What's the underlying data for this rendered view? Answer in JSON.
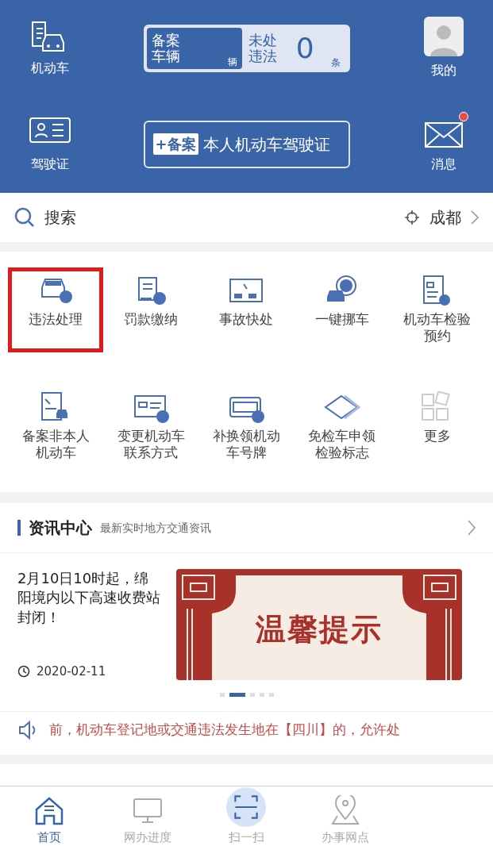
{
  "header": {
    "left_items": [
      {
        "label": "机动车",
        "kind": "car"
      },
      {
        "label": "驾驶证",
        "kind": "license"
      }
    ],
    "right_items": [
      {
        "label": "我的",
        "kind": "avatar"
      },
      {
        "label": "消息",
        "kind": "mail",
        "badge": true
      }
    ],
    "plate_card": {
      "label": "备案车辆",
      "unit": "辆",
      "violation_label": "未处违法",
      "count": "0",
      "count_unit": "条"
    },
    "add_card": {
      "tag": "+备案",
      "text": "本人机动车驾驶证"
    }
  },
  "search": {
    "placeholder": "搜索",
    "city": "成都"
  },
  "services": [
    {
      "label": "违法处理",
      "kind": "violation",
      "highlighted": true
    },
    {
      "label": "罚款缴纳",
      "kind": "fine",
      "highlighted": false
    },
    {
      "label": "事故快处",
      "kind": "accident",
      "highlighted": false
    },
    {
      "label": "一键挪车",
      "kind": "move",
      "highlighted": false
    },
    {
      "label": "机动车检验预约",
      "kind": "inspect",
      "highlighted": false
    },
    {
      "label": "备案非本人机动车",
      "kind": "record",
      "highlighted": false
    },
    {
      "label": "变更机动车联系方式",
      "kind": "change",
      "highlighted": false
    },
    {
      "label": "补换领机动车号牌",
      "kind": "plate",
      "highlighted": false
    },
    {
      "label": "免检车申领检验标志",
      "kind": "exempt",
      "highlighted": false
    },
    {
      "label": "更多",
      "kind": "more",
      "highlighted": false
    }
  ],
  "news": {
    "title": "资讯中心",
    "subtitle": "最新实时地方交通资讯",
    "article": {
      "title": "2月10日10时起，绵阳境内以下高速收费站封闭！",
      "date": "2020-02-11",
      "banner_text": "温馨提示"
    },
    "dots": [
      {
        "selected": false
      },
      {
        "selected": true
      },
      {
        "selected": false
      },
      {
        "selected": false
      },
      {
        "selected": false
      }
    ],
    "ticker": "前，机动车登记地或交通违法发生地在【四川】的，允许处"
  },
  "tabbar": [
    {
      "label": "首页",
      "kind": "home",
      "selected": true
    },
    {
      "label": "网办进度",
      "kind": "monitor",
      "selected": false
    },
    {
      "label": "扫一扫",
      "kind": "scan",
      "selected": false
    },
    {
      "label": "办事网点",
      "kind": "pin",
      "selected": false
    }
  ]
}
